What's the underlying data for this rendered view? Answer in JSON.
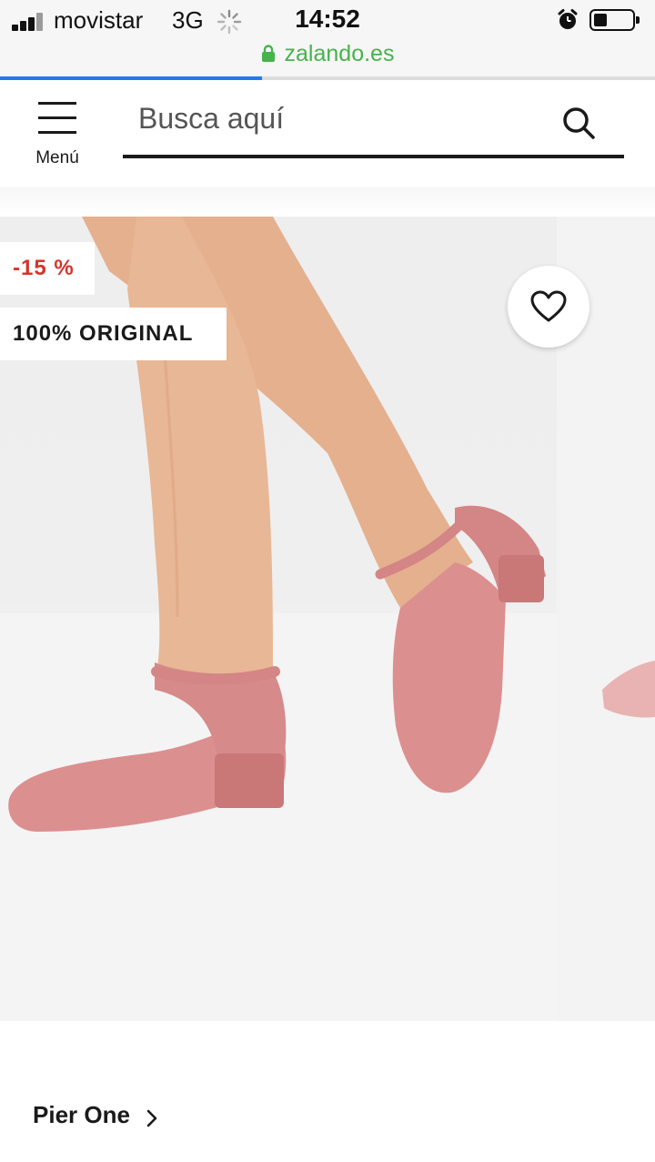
{
  "status_bar": {
    "carrier": "movistar",
    "network": "3G",
    "time": "14:52",
    "signal_bars": 3,
    "signal_bars_total": 4,
    "battery_level": 0.35,
    "icons": [
      "signal-icon",
      "activity-spinner-icon",
      "alarm-icon",
      "battery-icon"
    ]
  },
  "browser": {
    "url": "zalando.es",
    "secure": true,
    "load_progress": 0.4,
    "colors": {
      "url": "#48b24c",
      "progress": "#1e7cf2"
    }
  },
  "header": {
    "menu_label": "Menú",
    "search_placeholder": "Busca aquí",
    "search_value": "",
    "icons": [
      "hamburger-icon",
      "search-icon"
    ]
  },
  "product": {
    "discount_badge": "-15 %",
    "authenticity_badge": "100% ORIGINAL",
    "brand": "Pier One",
    "wishlisted": false,
    "icons": [
      "heart-icon",
      "chevron-right-icon"
    ],
    "colors": {
      "discount": "#d4352c",
      "shoe": "#dc8f8f"
    }
  }
}
